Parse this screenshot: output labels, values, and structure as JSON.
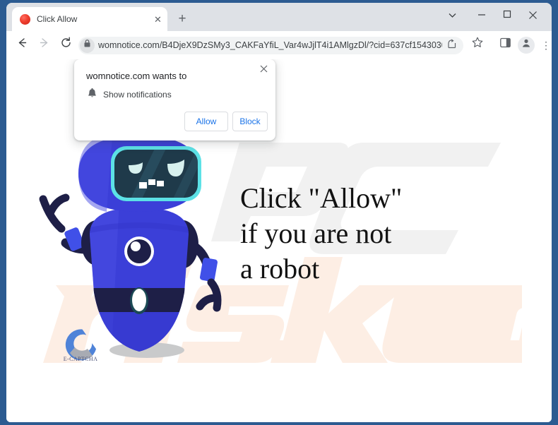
{
  "window": {
    "controls": {
      "tab_search": "⌄",
      "minimize": "—",
      "maximize": "□",
      "close": "✕"
    }
  },
  "tabstrip": {
    "active_tab": {
      "title": "Click Allow",
      "favicon": "red-circle-favicon",
      "close_label": "✕"
    },
    "new_tab_label": "+"
  },
  "toolbar": {
    "back_label": "←",
    "forward_label": "→",
    "reload_label": "⟳",
    "lock_label": "🔒",
    "url": "womnotice.com/B4DjeX9DzSMy3_CAKFaYfiL_Var4wJjlT4i1AMlgzDl/?cid=637cf1543030f...",
    "share_label": "⤴",
    "bookmark_label": "☆",
    "sidepanel_label": "◫",
    "profile_label": "👤",
    "menu_label": "⋮"
  },
  "permission_bubble": {
    "title": "womnotice.com wants to",
    "option_label": "Show notifications",
    "bell_icon": "🔔",
    "close_label": "✕",
    "allow_label": "Allow",
    "block_label": "Block"
  },
  "page": {
    "headline_line1": "Click \"Allow\"",
    "headline_line2": "if you are not",
    "headline_line3": "a robot",
    "captcha_label": "E-CAPTCHA",
    "watermark_top": "PC",
    "watermark_bottom": "risk.com"
  },
  "colors": {
    "window_frame": "#2c5b91",
    "tabstrip_bg": "#dee1e6",
    "toolbar_bg": "#ffffff",
    "omnibox_bg": "#f1f3f4",
    "accent_blue": "#1a73e8",
    "robot_body": "#3b3fd8",
    "robot_dark": "#1e1f47",
    "robot_visor": "#1f3a4a",
    "robot_visor_border": "#5ce1e6",
    "watermark_gray": "#f1f1f1",
    "watermark_peach": "#fdeee4"
  }
}
